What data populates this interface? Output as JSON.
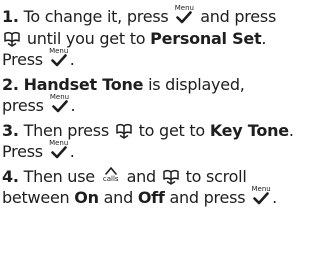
{
  "steps": [
    {
      "number": "1.",
      "part1": "To change it, press",
      "part2": "and press",
      "part3": "until you get to",
      "target": "Personal Set",
      "part4": ".",
      "part5": "Press",
      "part6": "."
    },
    {
      "number": "2.",
      "target": "Handset Tone",
      "part1": "is displayed,",
      "part2": "press",
      "part3": "."
    },
    {
      "number": "3.",
      "part1": "Then press",
      "part2": "to get to",
      "target": "Key Tone",
      "part3": ".",
      "part4": "Press",
      "part5": "."
    },
    {
      "number": "4.",
      "part1": "Then use",
      "part2": "and",
      "part3": "to scroll",
      "part4": "between",
      "on": "On",
      "part5": "and",
      "off": "Off",
      "part6": "and press",
      "part7": "."
    }
  ],
  "keys": {
    "menu_label": "Menu",
    "menu_icon": "checkmark-icon",
    "phonebook_icon": "phonebook-icon",
    "calls_label": "calls",
    "calls_icon": "up-arrow-icon"
  }
}
